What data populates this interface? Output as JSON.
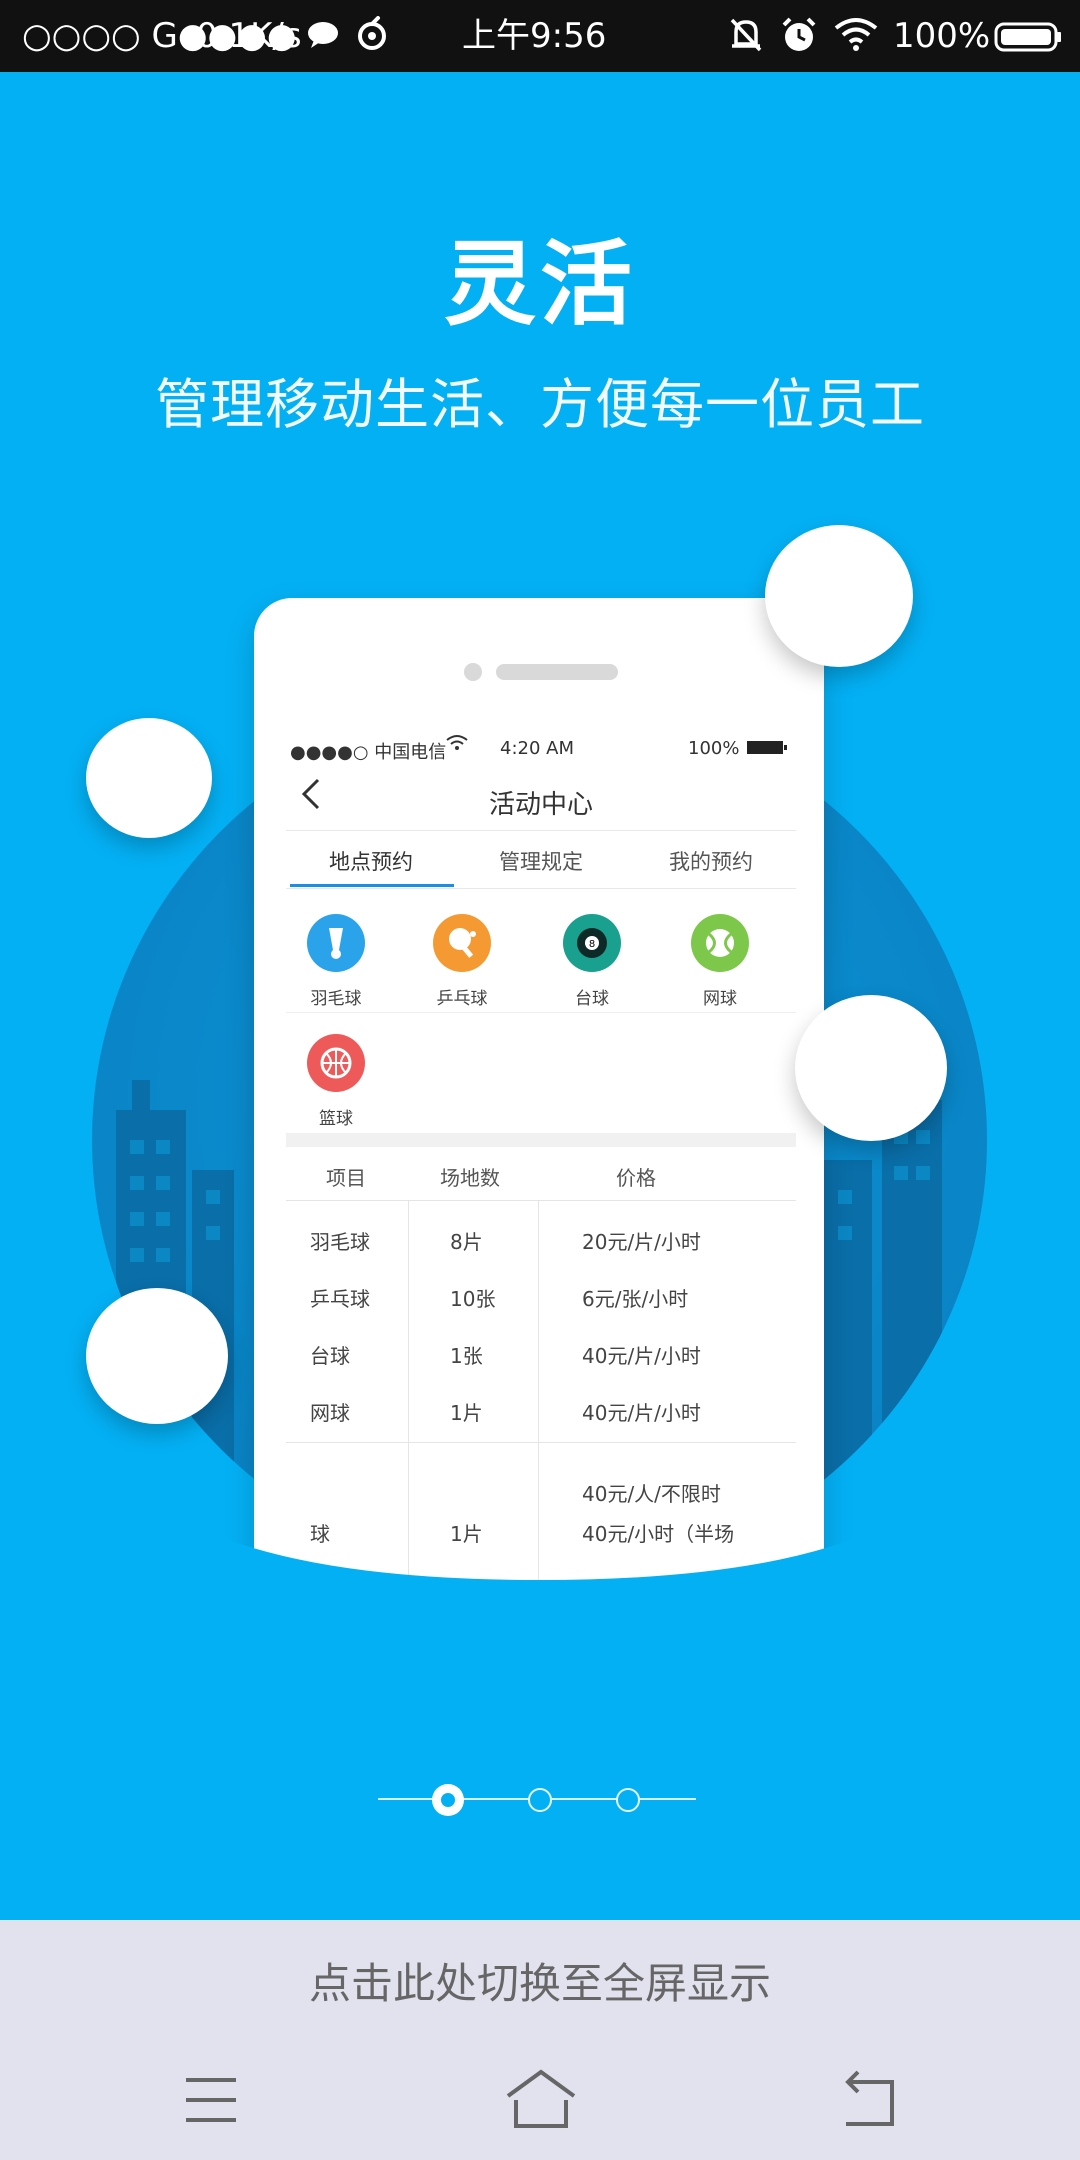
{
  "status_bar": {
    "signal_text": "○○○○ G●●●●",
    "speed": "0.1K/s",
    "time": "上午9:56",
    "battery": "100%"
  },
  "hero": {
    "title": "灵活",
    "subtitle": "管理移动生活、方便每一位员工"
  },
  "mock_phone": {
    "status": {
      "carrier": "●●●●○ 中国电信",
      "time": "4:20 AM",
      "battery": "100%"
    },
    "nav_title": "活动中心",
    "tabs": [
      {
        "label": "地点预约",
        "active": true
      },
      {
        "label": "管理规定",
        "active": false
      },
      {
        "label": "我的预约",
        "active": false
      }
    ],
    "sports": [
      {
        "label": "羽毛球",
        "color": "#2aa3ea",
        "icon": "shuttlecock-icon"
      },
      {
        "label": "乒乓球",
        "color": "#f59a32",
        "icon": "ping-pong-icon"
      },
      {
        "label": "台球",
        "color": "#19a08e",
        "icon": "billiards-icon"
      },
      {
        "label": "网球",
        "color": "#7dc84a",
        "icon": "tennis-icon"
      },
      {
        "label": "篮球",
        "color": "#ee5a5a",
        "icon": "basketball-icon"
      }
    ],
    "table": {
      "headers": [
        "项目",
        "场地数",
        "价格"
      ],
      "rows": [
        [
          "羽毛球",
          "8片",
          "20元/片/小时"
        ],
        [
          "乒乓球",
          "10张",
          "6元/张/小时"
        ],
        [
          "台球",
          "1张",
          "40元/片/小时"
        ],
        [
          "网球",
          "1片",
          "40元/片/小时"
        ]
      ],
      "last_row": {
        "name": "球",
        "count": "1片",
        "prices": [
          "40元/人/不限时",
          "40元/小时（半场"
        ]
      }
    }
  },
  "pager": {
    "pages": 3,
    "active_index": 0
  },
  "fullscreen_hint": "点击此处切换至全屏显示",
  "nav_bar": {
    "menu_icon": "menu-icon",
    "home_icon": "home-icon",
    "back_icon": "back-icon"
  },
  "colors": {
    "background": "#04b0f4",
    "circle": "#0a86c8",
    "bottom_bar": "#e2e2ef"
  }
}
